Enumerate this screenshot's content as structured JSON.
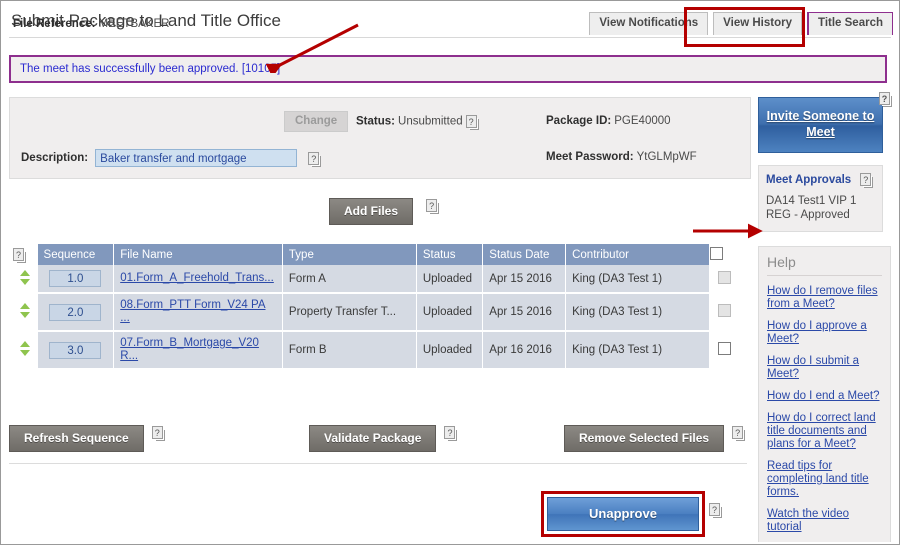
{
  "header": {
    "title": "Submit Package to Land Title Office",
    "tabs": [
      {
        "label": "View Notifications"
      },
      {
        "label": "View History"
      },
      {
        "label": "Title Search"
      }
    ]
  },
  "message": {
    "text": "The meet has successfully been approved. [10105]",
    "border_color": "#8e2f8e",
    "text_color": "#2b2bd0"
  },
  "info": {
    "file_reference_label": "File Reference:",
    "file_reference_value": "MEETBAKER",
    "change_button": "Change",
    "status_label": "Status:",
    "status_value": "Unsubmitted",
    "package_id_label": "Package ID:",
    "package_id_value": "PGE40000",
    "description_label": "Description:",
    "description_value": "Baker transfer and mortgage",
    "meet_password_label": "Meet Password:",
    "meet_password_value": "YtGLMpWF"
  },
  "toolbar": {
    "add_files_label": "Add Files"
  },
  "table": {
    "columns": [
      "Sequence",
      "File Name",
      "Type",
      "Status",
      "Status Date",
      "Contributor"
    ],
    "rows": [
      {
        "sequence": "1.0",
        "file_name": "01.Form_A_Freehold_Trans...",
        "type": "Form A",
        "status": "Uploaded",
        "status_date": "Apr 15 2016",
        "contributor": "King (DA3 Test 1)",
        "checkbox_enabled": false
      },
      {
        "sequence": "2.0",
        "file_name": "08.Form_PTT Form_V24 PA ...",
        "type": "Property Transfer T...",
        "status": "Uploaded",
        "status_date": "Apr 15 2016",
        "contributor": "King (DA3 Test 1)",
        "checkbox_enabled": false
      },
      {
        "sequence": "3.0",
        "file_name": "07.Form_B_Mortgage_V20 R...",
        "type": "Form B",
        "status": "Uploaded",
        "status_date": "Apr 16 2016",
        "contributor": "King (DA3 Test 1)",
        "checkbox_enabled": true
      }
    ],
    "header_color": "#8198bd",
    "row_color": "#d5dae3"
  },
  "actions": {
    "refresh_sequence": "Refresh Sequence",
    "validate_package": "Validate Package",
    "remove_selected_files": "Remove Selected Files",
    "unapprove": "Unapprove"
  },
  "sidebar": {
    "invite_label": "Invite Someone to Meet",
    "approvals_title": "Meet Approvals",
    "approvals_item": "DA14 Test1 VIP 1 REG - Approved",
    "help_title": "Help",
    "help_links": [
      "How do I remove files from a Meet?",
      "How do I approve a Meet?",
      "How do I submit a Meet?",
      "How do I end a Meet?",
      "How do I correct land title documents and plans for a Meet?",
      "Read tips for completing land title forms.",
      "Watch the video tutorial"
    ]
  },
  "icons": {
    "help": "?"
  },
  "annotations": {
    "highlight_color": "#b40000",
    "tab_box_target": "View History",
    "arrow1_target": "success message",
    "arrow2_target": "Meet Approvals",
    "unapprove_box_target": "Unapprove"
  }
}
